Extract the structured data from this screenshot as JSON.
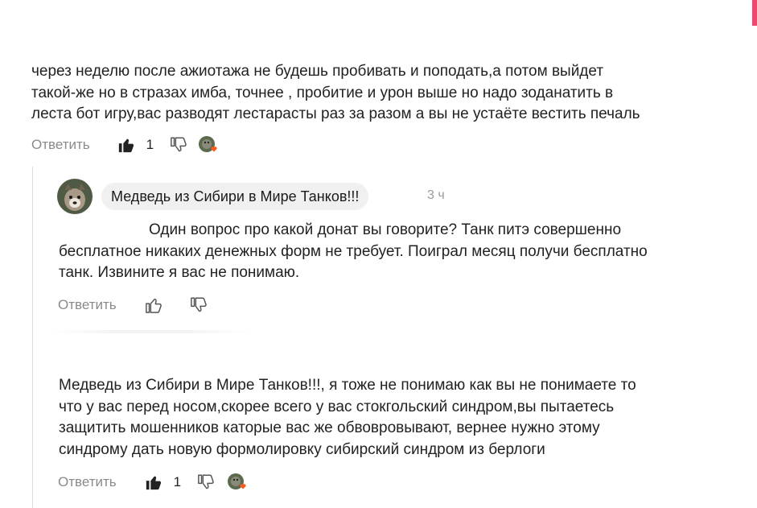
{
  "comment1": {
    "lines": [
      "через неделю после ажиотажа не будешь пробивать и поподать,а потом выйдет",
      "такой-же но в стразах имба, точнее , пробитие и урон выше но надо зоданатить в",
      "леста бот игру,вас разводят лестарасты раз за разом а вы не устаёте вестить печаль"
    ],
    "actions": {
      "reply_label": "Ответить",
      "like_count": "1",
      "like_icon": "thumb-up-filled",
      "dislike_icon": "thumb-down-outline",
      "reaction_icon": "avatar-with-heart"
    }
  },
  "reply1": {
    "author": "Медведь из Сибири в Мире Танков!!!",
    "time": "3 ч",
    "lines": [
      "Один вопрос про какой донат вы говорите? Танк питэ совершенно",
      "бесплатное никаких денежных форм не требует. Поиграл месяц получи бесплатно",
      "танк. Извините я вас не понимаю."
    ],
    "actions": {
      "reply_label": "Ответить",
      "like_icon": "thumb-up-outline",
      "dislike_icon": "thumb-down-outline"
    }
  },
  "reply2": {
    "lines": [
      "Медведь из Сибири в Мире Танков!!!, я тоже не понимаю как вы не понимаете то",
      "что у вас перед носом,скорее всего у вас стокгольский синдром,вы пытаетесь",
      "защитить мошенников каторые вас же обвовровывают, вернее нужно этому",
      "синдрому дать новую формолировку сибирский синдром из берлоги"
    ],
    "actions": {
      "reply_label": "Ответить",
      "like_count": "1",
      "like_icon": "thumb-up-filled",
      "dislike_icon": "thumb-down-outline",
      "reaction_icon": "avatar-with-heart"
    }
  },
  "colors": {
    "accent": "#f0476a",
    "muted_text": "#8a8a8a",
    "heart": "#ff5a1f",
    "pill_bg": "#f0f0f0"
  }
}
